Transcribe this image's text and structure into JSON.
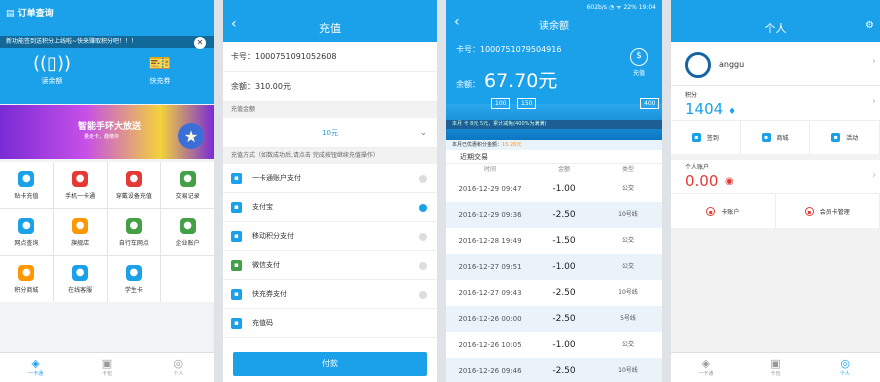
{
  "panel1": {
    "title": "订单查询",
    "marquee": "新功能签到送积分上线啦~快来赚取积分吧！！！",
    "read_balance": "读余额",
    "quick_charge": "快充券",
    "banner_title": "智能手环大放送",
    "banner_sub": "量走卡，趣缴存",
    "grid": [
      {
        "label": "贴卡充值",
        "color": "#1aa1ea",
        "icon": "card-icon"
      },
      {
        "label": "手机一卡通",
        "color": "#e53935",
        "icon": "phone-icon"
      },
      {
        "label": "穿戴设备充值",
        "color": "#e53935",
        "icon": "watch-icon"
      },
      {
        "label": "交易记录",
        "color": "#43a047",
        "icon": "list-icon"
      },
      {
        "label": "网点查询",
        "color": "#1aa1ea",
        "icon": "location-icon"
      },
      {
        "label": "旗舰店",
        "color": "#ff9800",
        "icon": "star-icon"
      },
      {
        "label": "自行车网点",
        "color": "#43a047",
        "icon": "bike-icon"
      },
      {
        "label": "企业账户",
        "color": "#43a047",
        "icon": "shield-icon"
      },
      {
        "label": "积分商城",
        "color": "#ff9800",
        "icon": "coins-icon"
      },
      {
        "label": "在线客服",
        "color": "#1aa1ea",
        "icon": "service-icon"
      },
      {
        "label": "学生卡",
        "color": "#1aa1ea",
        "icon": "student-icon"
      }
    ],
    "tabs": [
      "一卡通",
      "卡包",
      "个人"
    ]
  },
  "panel2": {
    "title": "充值",
    "card_no": "卡号：1000751091052608",
    "balance": "余额：310.00元",
    "amount_section": "充值金额",
    "amount": "10元",
    "method_section": "充值方式（如数成功后,请点击 完成按钮继续充值操作）",
    "methods": [
      "一卡通账户支付",
      "支付宝",
      "移动积分支付",
      "微信支付",
      "快充券支付",
      "充值码"
    ],
    "pay_button": "付款"
  },
  "panel3": {
    "status": "602b/s ◔ ᯤ 22% 19:04",
    "title": "读余额",
    "card_no": "卡号：1000751079504916",
    "balance_label": "余额：",
    "balance": "67.70元",
    "charge": "充值",
    "tags": [
      "100",
      "150",
      "400"
    ],
    "train_text": "本月 卡  8元        5元，累计减免(400%为满满)",
    "month_text": "本月已优惠积分金额：",
    "month_value": "15.26元",
    "recent": "近期交易",
    "headers": [
      "时间",
      "金额",
      "类型"
    ],
    "rows": [
      [
        "2016-12-29 09:47",
        "-1.00",
        "公交"
      ],
      [
        "2016-12-29 09:36",
        "-2.50",
        "10号线"
      ],
      [
        "2016-12-28 19:49",
        "-1.50",
        "公交"
      ],
      [
        "2016-12-27 09:51",
        "-1.00",
        "公交"
      ],
      [
        "2016-12-27 09:43",
        "-2.50",
        "10号线"
      ],
      [
        "2016-12-26 00:00",
        "-2.50",
        "5号线"
      ],
      [
        "2016-12-26 10:05",
        "-1.00",
        "公交"
      ],
      [
        "2016-12-26 09:46",
        "-2.50",
        "10号线"
      ]
    ]
  },
  "panel4": {
    "title": "个人",
    "username": "anggu",
    "points_label": "积分",
    "points": "1404",
    "actions": [
      "签到",
      "商城",
      "活动"
    ],
    "account_label": "个人账户",
    "account_value": "0.00",
    "actions2": [
      "卡账户",
      "会员卡管理"
    ],
    "tabs": [
      "一卡通",
      "卡包",
      "个人"
    ]
  }
}
